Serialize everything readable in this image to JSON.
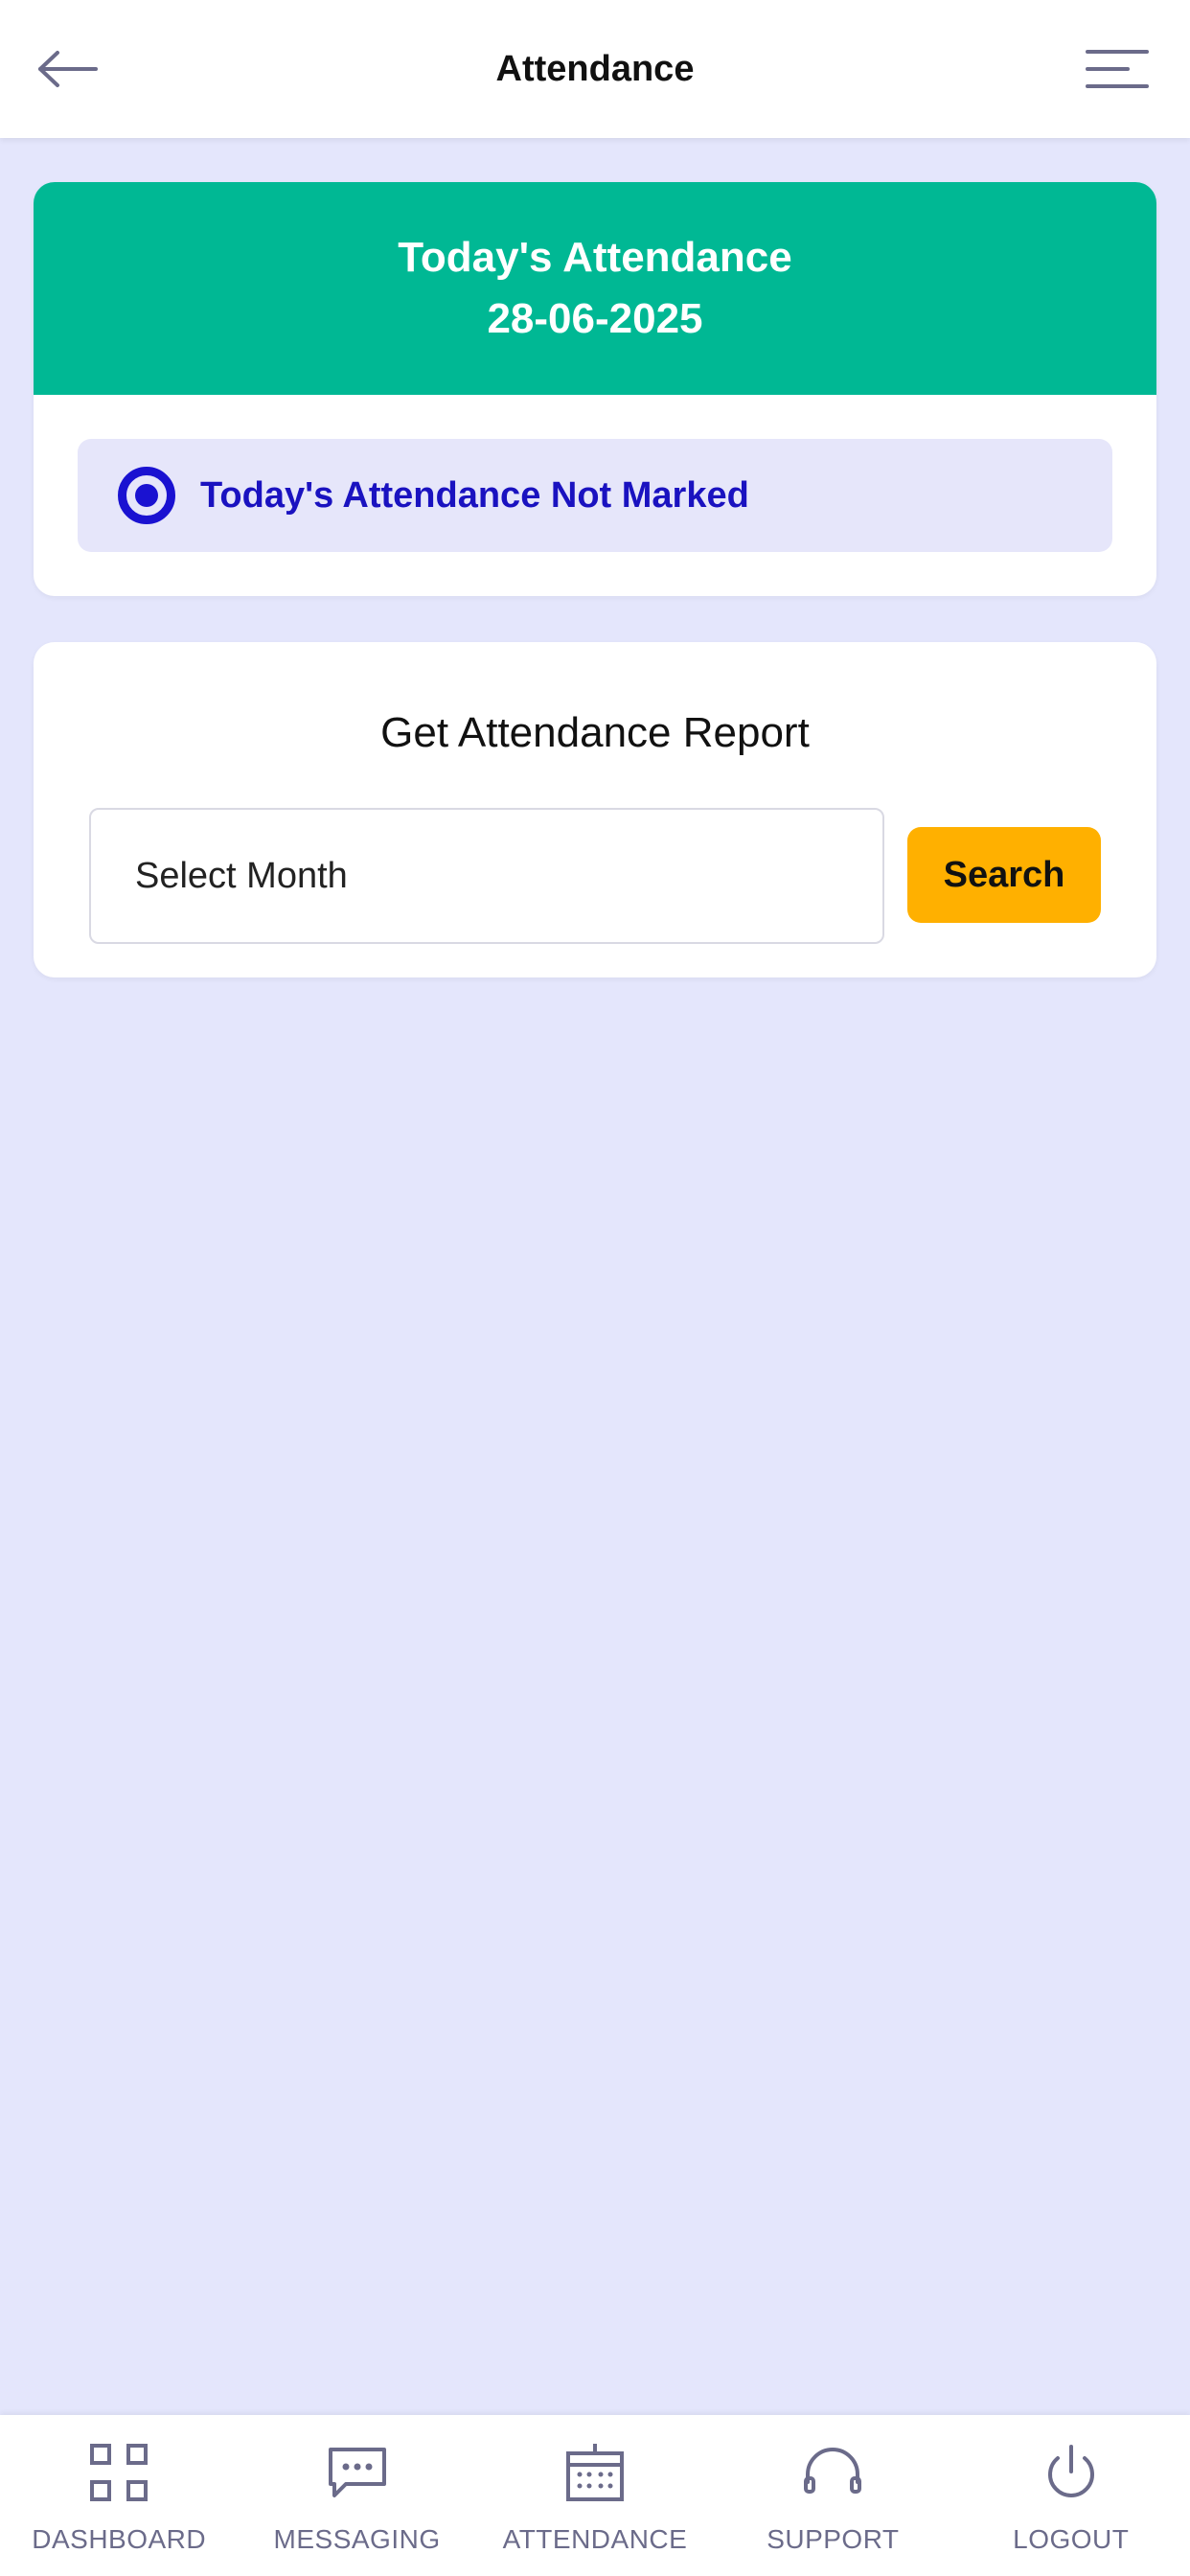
{
  "header": {
    "title": "Attendance",
    "back_icon": "arrow-left-icon",
    "menu_icon": "menu-icon"
  },
  "today_card": {
    "heading": "Today's Attendance",
    "date": "28-06-2025",
    "status_text": "Today's Attendance Not Marked",
    "banner_color": "#00b894",
    "status_color": "#1a12d1"
  },
  "report_card": {
    "title": "Get Attendance Report",
    "month_select": {
      "placeholder": "Select Month"
    },
    "search_label": "Search",
    "search_color": "#ffb000"
  },
  "bottom_nav": {
    "items": [
      {
        "label": "DASHBOARD",
        "icon": "grid-icon"
      },
      {
        "label": "MESSAGING",
        "icon": "chat-icon"
      },
      {
        "label": "ATTENDANCE",
        "icon": "calendar-icon"
      },
      {
        "label": "SUPPORT",
        "icon": "headset-icon"
      },
      {
        "label": "LOGOUT",
        "icon": "power-icon"
      }
    ]
  },
  "colors": {
    "background": "#e4e6fc",
    "icon": "#6b6b8a"
  }
}
